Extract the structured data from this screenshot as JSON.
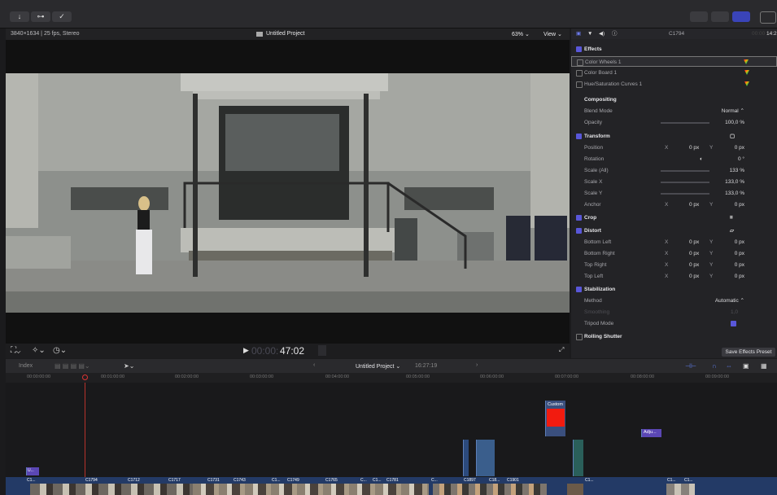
{
  "toolbar": {
    "import_icon": "↓",
    "key_icon": "⊶",
    "check_icon": "✓"
  },
  "viewer": {
    "format": "3840×1634 | 25 fps, Stereo",
    "project": "Untitled Project",
    "zoom": "63% ⌄",
    "view_menu": "View ⌄",
    "timecode_dim": "00:00:",
    "timecode": "47:02"
  },
  "inspector": {
    "clip_name": "C1794",
    "duration_dim": "00:00",
    "duration": "14:2",
    "effects_title": "Effects",
    "effects": [
      "Color Wheels 1",
      "Color Board 1",
      "Hue/Saturation Curves 1"
    ],
    "compositing": {
      "title": "Compositing",
      "blend_label": "Blend Mode",
      "blend_value": "Normal ⌃",
      "opacity_label": "Opacity",
      "opacity_value": "100,0 %"
    },
    "transform": {
      "title": "Transform",
      "position_label": "Position",
      "x": "X",
      "y": "Y",
      "pos_x": "0 px",
      "pos_y": "0 px",
      "rotation_label": "Rotation",
      "rotation_value": "0 °",
      "scale_all_label": "Scale (All)",
      "scale_all_value": "133 %",
      "scale_x_label": "Scale X",
      "scale_x_value": "133,0 %",
      "scale_y_label": "Scale Y",
      "scale_y_value": "133,0 %",
      "anchor_label": "Anchor",
      "anchor_x": "0 px",
      "anchor_y": "0 px"
    },
    "crop_title": "Crop",
    "distort": {
      "title": "Distort",
      "rows": [
        {
          "label": "Bottom Left",
          "x": "0 px",
          "y": "0 px"
        },
        {
          "label": "Bottom Right",
          "x": "0 px",
          "y": "0 px"
        },
        {
          "label": "Top Right",
          "x": "0 px",
          "y": "0 px"
        },
        {
          "label": "Top Left",
          "x": "0 px",
          "y": "0 px"
        }
      ]
    },
    "stabilization": {
      "title": "Stabilization",
      "method_label": "Method",
      "method_value": "Automatic ⌃",
      "smoothing_label": "Smoothing",
      "smoothing_value": "1,0",
      "tripod_label": "Tripod Mode"
    },
    "rolling_shutter": "Rolling Shutter",
    "save_preset": "Save Effects Preset"
  },
  "timeline": {
    "index": "Index",
    "project": "Untitled Project ⌄",
    "duration": "16:27:19",
    "ruler": [
      "00:00:00:00",
      "00:01:00:00",
      "00:02:00:00",
      "00:03:00:00",
      "00:04:00:00",
      "00:05:00:00",
      "00:06:00:00",
      "00:07:00:00",
      "00:08:00:00",
      "00:09:00:00"
    ],
    "custom_label": "Custom",
    "adjust_label": "Adju...",
    "clips": [
      "C1...",
      "C1794",
      "C1712",
      "C1717",
      "C1731",
      "C1743",
      "C1...",
      "C1749",
      "C1765",
      "C...",
      "C1...",
      "C1781",
      "C...",
      "C1897",
      "C18...",
      "C1901",
      "C1...",
      "C1...",
      "C1..."
    ]
  }
}
